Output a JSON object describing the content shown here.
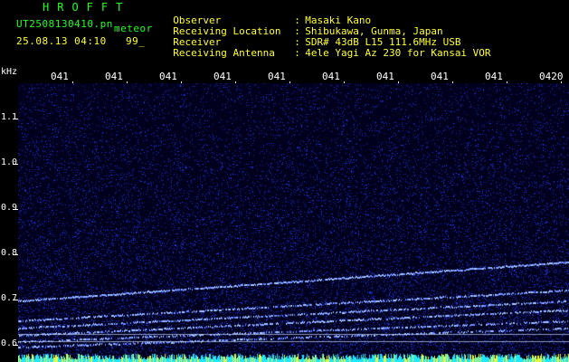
{
  "header": {
    "brand": "HROFFT",
    "filename": "UT2508130410.pn",
    "mode": "meteor",
    "datetime": "25.08.13 04:10",
    "counter": "99_"
  },
  "station": [
    {
      "label": "Observer",
      "value": "Masaki Kano"
    },
    {
      "label": "Receiving Location",
      "value": "Shibukawa, Gunma, Japan"
    },
    {
      "label": "Receiver",
      "value": "SDR# 43dB L15 111.6MHz USB"
    },
    {
      "label": "Receiving Antenna",
      "value": "4ele Yagi Az 230 for Kansai VOR"
    }
  ],
  "time_axis": {
    "labels": [
      "041",
      "041",
      "041",
      "041",
      "041",
      "041",
      "041",
      "041",
      "041",
      "0420"
    ]
  },
  "freq_axis": {
    "unit": "kHz",
    "labels": [
      "1.1",
      "1.0",
      "0.9",
      "0.8",
      "0.7",
      "0.6"
    ]
  },
  "colors": {
    "background": "#000000",
    "header_green": "#20ff20",
    "header_yellow": "#ffff30",
    "noise_blue": "#1a2cff",
    "trace_light": "#a8c8ff",
    "baseline_cyan": "#20e8ff"
  }
}
